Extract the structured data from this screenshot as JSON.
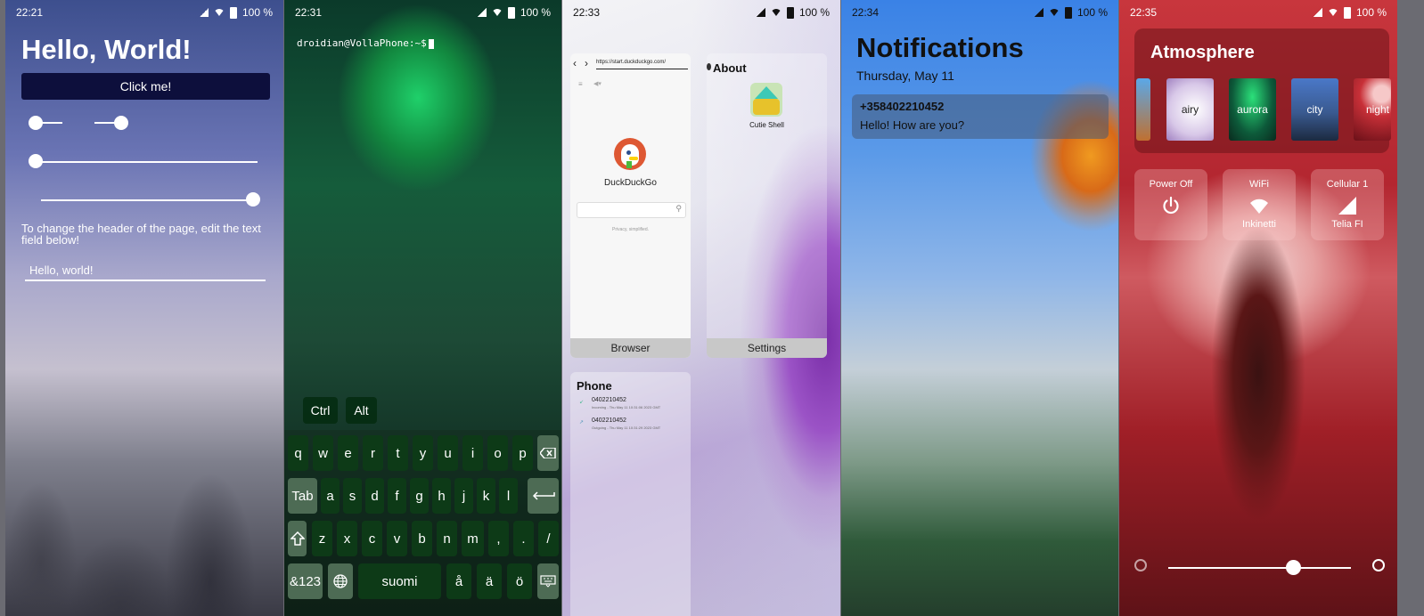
{
  "status_bar": {
    "times": [
      "22:21",
      "22:31",
      "22:33",
      "22:34",
      "22:35"
    ],
    "battery": "100 %"
  },
  "panel1": {
    "title": "Hello, World!",
    "button_label": "Click me!",
    "note": "To change the header of the page, edit the text field below!",
    "field_value": "Hello, world!",
    "switch1_on": false,
    "switch2_on": true,
    "slider1_value": 0,
    "slider2_value": 1
  },
  "panel2": {
    "prompt": "droidian@VollaPhone:~$",
    "modifiers": [
      "Ctrl",
      "Alt"
    ],
    "row1": [
      "q",
      "w",
      "e",
      "r",
      "t",
      "y",
      "u",
      "i",
      "o",
      "p"
    ],
    "row2": [
      "Tab",
      "a",
      "s",
      "d",
      "f",
      "g",
      "h",
      "j",
      "k",
      "l"
    ],
    "row3": [
      "z",
      "x",
      "c",
      "v",
      "b",
      "n",
      "m",
      ",",
      ".",
      "/"
    ],
    "row4": [
      "&123",
      "suomi",
      "å",
      "ä",
      "ö"
    ]
  },
  "panel3": {
    "browser": {
      "url": "https://start.duckduckgo.com/",
      "brand": "DuckDuckGo",
      "tagline": "Privacy, simplified.",
      "label": "Browser"
    },
    "settings": {
      "header": "About",
      "app": "Cutie Shell",
      "label": "Settings"
    },
    "phone": {
      "title": "Phone",
      "calls": [
        {
          "number": "0402210452",
          "detail": "Incoming - Thu May 11 10:31:06 2023 GMT"
        },
        {
          "number": "0402210452",
          "detail": "Outgoing - Thu May 11 10:31:29 2023 GMT"
        }
      ]
    }
  },
  "panel4": {
    "title": "Notifications",
    "date": "Thursday, May 11",
    "notification": {
      "sender": "+358402210452",
      "message": "Hello! How are you?"
    }
  },
  "panel5": {
    "title": "Atmosphere",
    "themes": [
      "airy",
      "aurora",
      "city",
      "night"
    ],
    "tiles": [
      {
        "title": "Power Off",
        "subtitle": ""
      },
      {
        "title": "WiFi",
        "subtitle": "Inkinetti"
      },
      {
        "title": "Cellular 1",
        "subtitle": "Telia FI"
      }
    ],
    "brightness_value": 0.68
  },
  "colors": {
    "button_bg": "#0d0f3c",
    "key_bg": "#0d3a17",
    "key_alt_bg": "#4d6b54",
    "ddg_orange": "#de5833"
  }
}
